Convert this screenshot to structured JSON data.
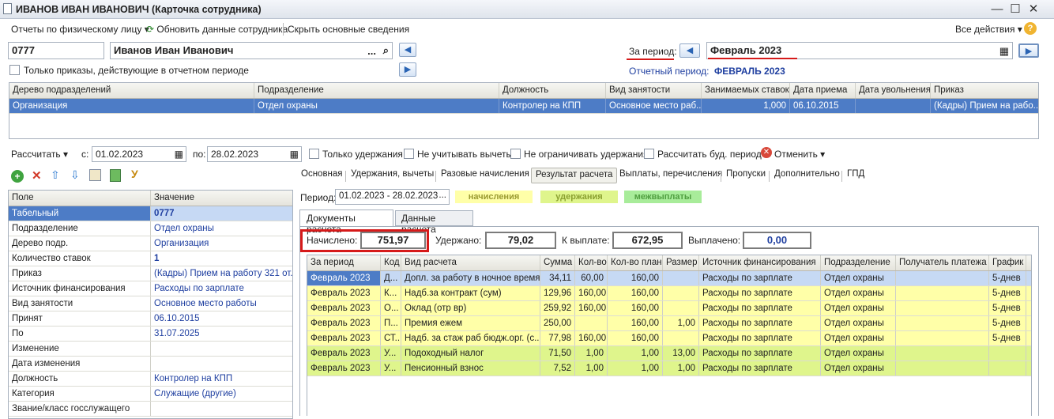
{
  "window": {
    "title": "ИВАНОВ ИВАН ИВАНОВИЧ (Карточка сотрудника)"
  },
  "toolbar": {
    "reports": "Отчеты по физическому лицу",
    "refresh": "Обновить данные сотрудника",
    "hide": "Скрыть основные сведения",
    "all_actions": "Все действия"
  },
  "employee": {
    "tab_no": "0777",
    "name": "Иванов Иван Иванович",
    "only_orders": "Только приказы, действующие в отчетном периоде"
  },
  "period": {
    "label": "За период:",
    "value": "Февраль 2023",
    "report_label": "Отчетный период:",
    "report_value": "ФЕВРАЛЬ 2023"
  },
  "top_grid": {
    "headers": [
      "Дерево подразделений",
      "Подразделение",
      "Должность",
      "Вид занятости",
      "Занимаемых ставок",
      "Дата приема",
      "Дата увольнения",
      "Приказ"
    ],
    "row": [
      "Организация",
      "Отдел охраны",
      "Контролер на КПП",
      "Основное место раб...",
      "1,000",
      "06.10.2015",
      "",
      "(Кадры) Прием на рабо..."
    ]
  },
  "calc_bar": {
    "calculate": "Рассчитать",
    "from_label": "с:",
    "from": "01.02.2023",
    "to_label": "по:",
    "to": "28.02.2023",
    "only_deductions": "Только удержания",
    "ignore_deductions": "Не учитывать вычеты",
    "no_limit": "Не ограничивать удержания",
    "future": "Рассчитать буд. период",
    "cancel": "Отменить"
  },
  "left_grid": {
    "headers": [
      "Поле",
      "Значение"
    ],
    "rows": [
      {
        "field": "Табельный",
        "value": "0777"
      },
      {
        "field": "Подразделение",
        "value": "Отдел охраны"
      },
      {
        "field": "Дерево подр.",
        "value": "Организация"
      },
      {
        "field": "Количество ставок",
        "value": "1"
      },
      {
        "field": "Приказ",
        "value": "(Кадры) Прием на работу 321 от..."
      },
      {
        "field": "Источник финансирования",
        "value": "Расходы по зарплате"
      },
      {
        "field": "Вид занятости",
        "value": "Основное место работы"
      },
      {
        "field": "Принят",
        "value": "06.10.2015"
      },
      {
        "field": "По",
        "value": "31.07.2025"
      },
      {
        "field": "Изменение",
        "value": ""
      },
      {
        "field": "Дата изменения",
        "value": ""
      },
      {
        "field": "Должность",
        "value": "Контролер на КПП"
      },
      {
        "field": "Категория",
        "value": "Служащие (другие)"
      },
      {
        "field": "Звание/класс госслужащего",
        "value": ""
      }
    ]
  },
  "tabs": [
    "Основная",
    "Удержания, вычеты",
    "Разовые начисления",
    "Результат расчета",
    "Выплаты, перечисления",
    "Пропуски",
    "Дополнительно",
    "ГПД"
  ],
  "result": {
    "period_label": "Период:",
    "period": "01.02.2023 - 28.02.2023",
    "legend": [
      "начисления",
      "удержания",
      "межвыплаты"
    ],
    "subtabs": [
      "Документы расчета",
      "Данные расчета"
    ],
    "accrued_label": "Начислено:",
    "accrued": "751,97",
    "withheld_label": "Удержано:",
    "withheld": "79,02",
    "topay_label": "К выплате:",
    "topay": "672,95",
    "paid_label": "Выплачено:",
    "paid": "0,00"
  },
  "calc_grid": {
    "headers": [
      "За период",
      "Код",
      "Вид расчета",
      "Сумма",
      "Кол-во",
      "Кол-во план",
      "Размер",
      "Источник финансирования",
      "Подразделение",
      "Получатель платежа",
      "График"
    ],
    "rows": [
      [
        "Февраль 2023",
        "Д...",
        "Допл. за работу в ночное время",
        "34,11",
        "60,00",
        "160,00",
        "",
        "Расходы по зарплате",
        "Отдел охраны",
        "",
        "5-днев"
      ],
      [
        "Февраль 2023",
        "К...",
        "Надб.за контракт (сум)",
        "129,96",
        "160,00",
        "160,00",
        "",
        "Расходы по зарплате",
        "Отдел охраны",
        "",
        "5-днев"
      ],
      [
        "Февраль 2023",
        "О...",
        "Оклад (отр вр)",
        "259,92",
        "160,00",
        "160,00",
        "",
        "Расходы по зарплате",
        "Отдел охраны",
        "",
        "5-днев"
      ],
      [
        "Февраль 2023",
        "П...",
        "Премия ежем",
        "250,00",
        "",
        "160,00",
        "1,00",
        "Расходы по зарплате",
        "Отдел охраны",
        "",
        "5-днев"
      ],
      [
        "Февраль 2023",
        "СТ...",
        "Надб. за стаж раб бюдж.орг. (с...",
        "77,98",
        "160,00",
        "160,00",
        "",
        "Расходы по зарплате",
        "Отдел охраны",
        "",
        "5-днев"
      ],
      [
        "Февраль 2023",
        "У...",
        "Подоходный налог",
        "71,50",
        "1,00",
        "1,00",
        "13,00",
        "Расходы по зарплате",
        "Отдел охраны",
        "",
        ""
      ],
      [
        "Февраль 2023",
        "У...",
        "Пенсионный взнос",
        "7,52",
        "1,00",
        "1,00",
        "1,00",
        "Расходы по зарплате",
        "Отдел охраны",
        "",
        ""
      ]
    ]
  },
  "colors": {
    "accrual": "#ffffa8",
    "deduction": "#dff58c",
    "selected": "#c6d9f4",
    "highlight": "#d61a1a"
  }
}
